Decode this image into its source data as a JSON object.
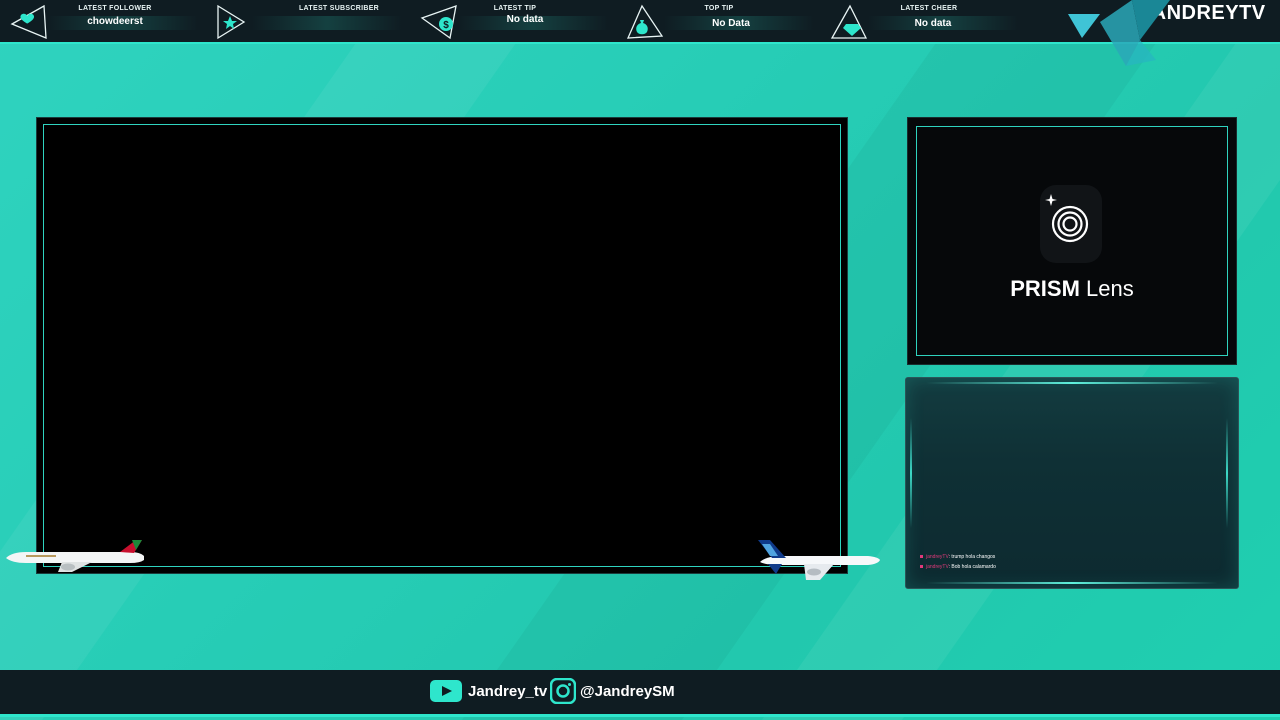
{
  "topbar": {
    "widgets": [
      {
        "title": "LATEST FOLLOWER",
        "value": "chowdeerst",
        "icon": "heart-icon"
      },
      {
        "title": "LATEST SUBSCRIBER",
        "value": "",
        "icon": "star-icon"
      },
      {
        "title": "LATEST TIP",
        "value": "No data",
        "icon": "dollar-icon"
      },
      {
        "title": "TOP TIP",
        "value": "No Data",
        "icon": "money-bag-icon"
      },
      {
        "title": "LATEST CHEER",
        "value": "No data",
        "icon": "diamond-icon"
      }
    ],
    "brand": "JANDREYTV"
  },
  "camera": {
    "logo_name": "PRISM",
    "logo_suffix": "Lens"
  },
  "chat": {
    "messages": [
      {
        "user": "jandreyTV",
        "text": ": trump hola changos"
      },
      {
        "user": "jandreyTV",
        "text": ": Bob hola calamardo"
      }
    ]
  },
  "footer": {
    "youtube": "Jandrey_tv",
    "instagram": "@JandreySM"
  },
  "colors": {
    "accent": "#2ee6cc",
    "bar_bg": "#0f1c22",
    "background": "#27cdb6"
  }
}
